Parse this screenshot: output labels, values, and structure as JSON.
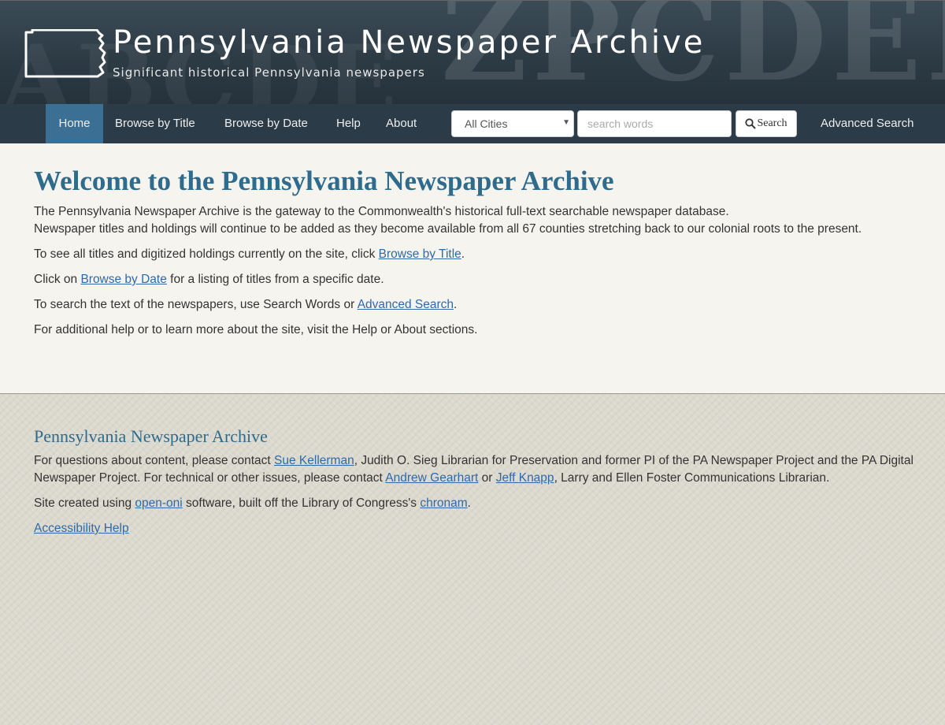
{
  "header": {
    "title": "Pennsylvania Newspaper Archive",
    "subtitle": "Significant historical Pennsylvania newspapers",
    "logo_icon": "pennsylvania-state-outline-icon"
  },
  "nav": {
    "items": [
      {
        "label": "Home",
        "active": true
      },
      {
        "label": "Browse by Title",
        "active": false
      },
      {
        "label": "Browse by Date",
        "active": false
      },
      {
        "label": "Help",
        "active": false
      },
      {
        "label": "About",
        "active": false
      }
    ],
    "city_select": {
      "selected": "All Cities"
    },
    "search": {
      "placeholder": "search words",
      "button_label": "Search",
      "icon": "search-icon"
    },
    "advanced_search_label": "Advanced Search"
  },
  "main": {
    "heading": "Welcome to the Pennsylvania Newspaper Archive",
    "intro_line1": "The Pennsylvania Newspaper Archive is the gateway to the Commonwealth's historical full-text searchable newspaper database.",
    "intro_line2": "Newspaper titles and holdings will continue to be added as they become available from all 67 counties stretching back to our colonial roots to the present.",
    "p_titles": {
      "before": "To see all titles and digitized holdings currently on the site, click ",
      "link": "Browse by Title",
      "after": "."
    },
    "p_date": {
      "before": "Click on ",
      "link": "Browse by Date",
      "after": " for a listing of titles from a specific date."
    },
    "p_search": {
      "before": "To search the text of the newspapers, use Search Words or ",
      "link": "Advanced Search",
      "after": "."
    },
    "p_help": "For additional help or to learn more about the site, visit the Help or About sections."
  },
  "footer": {
    "heading": "Pennsylvania Newspaper Archive",
    "contact": {
      "t1": "For questions about content, please contact ",
      "link1": "Sue Kellerman",
      "t2": ", Judith O. Sieg Librarian for Preservation and former PI of the PA Newspaper Project and the PA Digital Newspaper Project. For technical or other issues, please contact ",
      "link2": "Andrew Gearhart",
      "t3": " or ",
      "link3": "Jeff Knapp",
      "t4": ", Larry and Ellen Foster Communications Librarian."
    },
    "credits": {
      "t1": "Site created using ",
      "link1": "open-oni",
      "t2": " software, built off the Library of Congress's ",
      "link2": "chronam",
      "t3": "."
    },
    "accessibility_label": "Accessibility Help"
  },
  "colors": {
    "heading": "#2e6b8c",
    "link": "#2f6aa8",
    "nav_bg": "#2b3b47",
    "nav_active": "#3b6f93"
  }
}
